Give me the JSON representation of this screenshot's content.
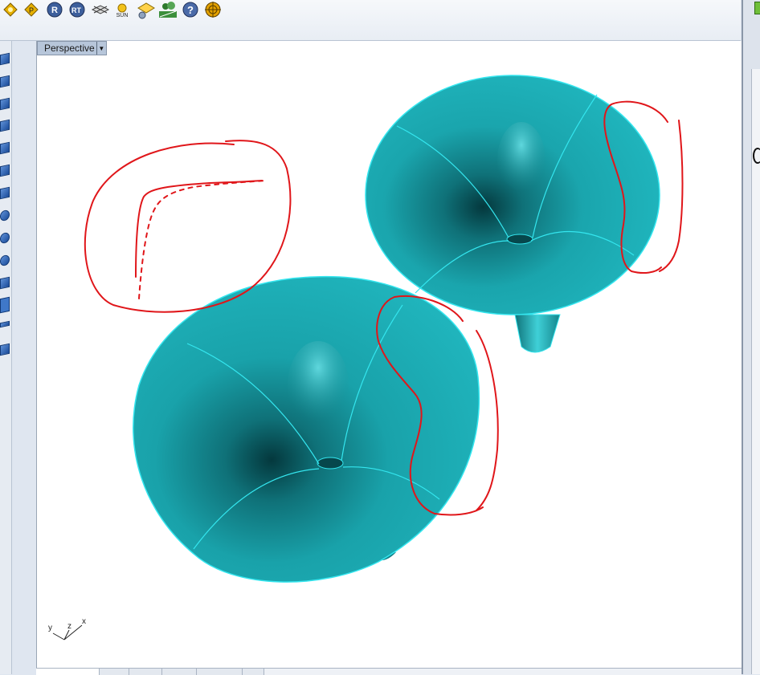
{
  "viewport": {
    "title": "Perspective"
  },
  "toolbar": {
    "icons": [
      "render-icon",
      "render-preview-icon",
      "rhino-render-icon",
      "raytrace-icon",
      "light-icon",
      "sun-icon",
      "material-icon",
      "environment-icon",
      "help-icon",
      "target-icon"
    ],
    "sun_label": "SUN",
    "r_label": "R",
    "rt_label": "RT",
    "help_label": "?"
  },
  "axes": {
    "y": "y",
    "z": "z",
    "x": "x"
  },
  "colors": {
    "surface": "#1aa3ab",
    "surface_dark": "#034b52",
    "edge": "#34e6ef",
    "annotation": "#e0161a"
  }
}
